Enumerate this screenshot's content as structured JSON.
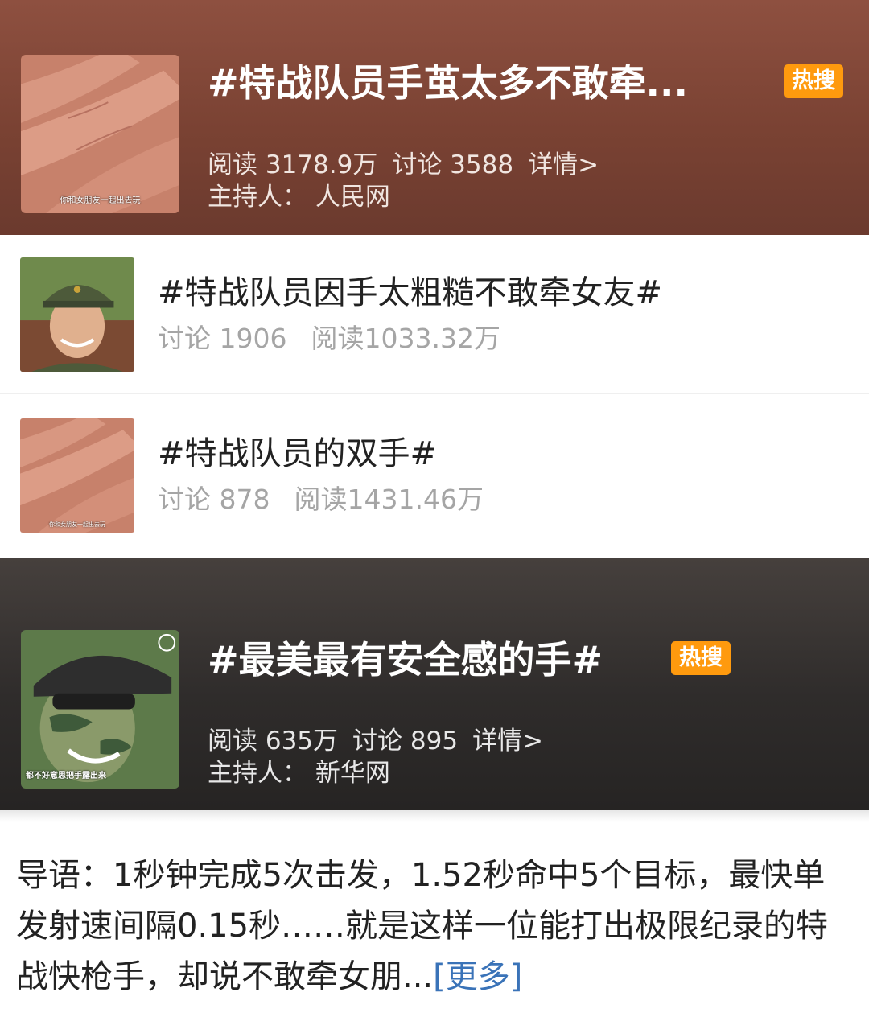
{
  "topics": [
    {
      "title": "#特战队员手茧太多不敢牵...",
      "badge": "热搜",
      "stats": [
        "阅读 3178.9万",
        "讨论 3588",
        "详情>"
      ],
      "host": "主持人： 人民网",
      "thumb_caption": "你和女朋友一起出去玩"
    },
    {
      "title": "#特战队员因手太粗糙不敢牵女友#",
      "stats": [
        "讨论 1906",
        "阅读1033.32万"
      ]
    },
    {
      "title": "#特战队员的双手#",
      "stats": [
        "讨论 878",
        "阅读1431.46万"
      ],
      "thumb_caption": "你和女朋友一起出去玩"
    },
    {
      "title": "#最美最有安全感的手#",
      "badge": "热搜",
      "stats": [
        "阅读 635万",
        "讨论 895",
        "详情>"
      ],
      "host": "主持人： 新华网",
      "thumb_caption": "都不好意思把手露出来"
    }
  ],
  "intro": {
    "text": "导语：1秒钟完成5次击发，1.52秒命中5个目标，最快单发射速间隔0.15秒……就是这样一位能打出极限纪录的特战快枪手，却说不敢牵女朋...",
    "more": "[更多]"
  },
  "colors": {
    "hero_a": "#7a4233",
    "hero_b": "#2f2c2b",
    "badge": "#ff9a0e",
    "link": "#3a73b8"
  }
}
